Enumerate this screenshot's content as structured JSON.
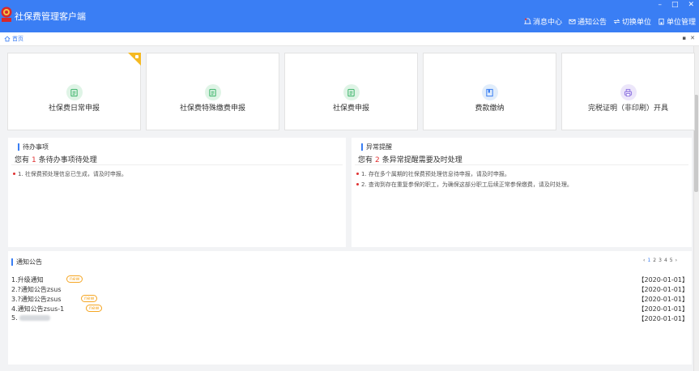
{
  "app": {
    "title": "社保费管理客户端"
  },
  "window_controls": {
    "minimize": "–",
    "maximize": "□",
    "close": "✕"
  },
  "header_nav": [
    {
      "label": "消息中心",
      "icon": "bell-icon"
    },
    {
      "label": "通知公告",
      "icon": "mail-icon"
    },
    {
      "label": "切换单位",
      "icon": "switch-icon"
    },
    {
      "label": "单位管理",
      "icon": "building-icon"
    }
  ],
  "tab": {
    "home": "首页",
    "pin": "▪",
    "close": "✕"
  },
  "cards": [
    {
      "label": "社保费日常申报",
      "icon": "document-icon",
      "icon_bg": "#dff4e6",
      "icon_color": "#3cb46a",
      "flagged": true
    },
    {
      "label": "社保费特殊缴费申报",
      "icon": "document-icon",
      "icon_bg": "#dff4e6",
      "icon_color": "#3cb46a",
      "flagged": false
    },
    {
      "label": "社保费申报",
      "icon": "document-icon",
      "icon_bg": "#dff4e6",
      "icon_color": "#3cb46a",
      "flagged": false
    },
    {
      "label": "费款缴纳",
      "icon": "book-icon",
      "icon_bg": "#e1edfb",
      "icon_color": "#3a7ef4",
      "flagged": false
    },
    {
      "label": "完税证明（非印刷）开具",
      "icon": "printer-icon",
      "icon_bg": "#ece6fa",
      "icon_color": "#8a6fe0",
      "flagged": false
    }
  ],
  "todo": {
    "title": "待办事项",
    "sub_pre": "您有",
    "count": "1",
    "sub_post": "条待办事项待处理",
    "items": [
      "1. 社保费预处理信息已生成，请及时申报。"
    ]
  },
  "alerts": {
    "title": "异常提醒",
    "sub_pre": "您有",
    "count": "2",
    "sub_post": "条异常提醒需要及时处理",
    "items": [
      "1. 存在多个属期的社保费预处理信息待申报，请及时申报。",
      "2. 查询到存在重复参保的职工，为确保这部分职工后续正常参保缴费，请及时处理。"
    ]
  },
  "notices": {
    "title": "通知公告",
    "pager": [
      "‹",
      "1",
      "2",
      "3",
      "4",
      "5",
      "›"
    ],
    "new_label": "new",
    "items": [
      {
        "title": "1.升级通知",
        "date": "【2020-01-01】",
        "is_new": true
      },
      {
        "title": "2.?通知公告zsus",
        "date": "【2020-01-01】",
        "is_new": false
      },
      {
        "title": "3.?通知公告zsus",
        "date": "【2020-01-01】",
        "is_new": true
      },
      {
        "title": "4.通知公告zsus-1",
        "date": "【2020-01-01】",
        "is_new": true
      },
      {
        "title": "5.",
        "date": "【2020-01-01】",
        "is_new": false,
        "blurred": true
      }
    ]
  }
}
